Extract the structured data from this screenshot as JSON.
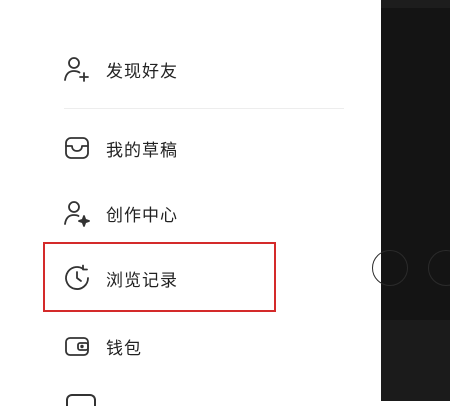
{
  "menu": {
    "items": [
      {
        "id": "find-friends",
        "label": "发现好友",
        "icon": "add-user-icon"
      },
      {
        "id": "drafts",
        "label": "我的草稿",
        "icon": "drafts-tray-icon"
      },
      {
        "id": "creator-center",
        "label": "创作中心",
        "icon": "creator-user-star-icon"
      },
      {
        "id": "history",
        "label": "浏览记录",
        "icon": "clock-history-icon"
      },
      {
        "id": "wallet",
        "label": "钱包",
        "icon": "wallet-icon"
      }
    ]
  },
  "colors": {
    "highlight_border": "#d42a2a",
    "text": "#222222",
    "icon": "#333333",
    "overlay_background": "#141414"
  }
}
